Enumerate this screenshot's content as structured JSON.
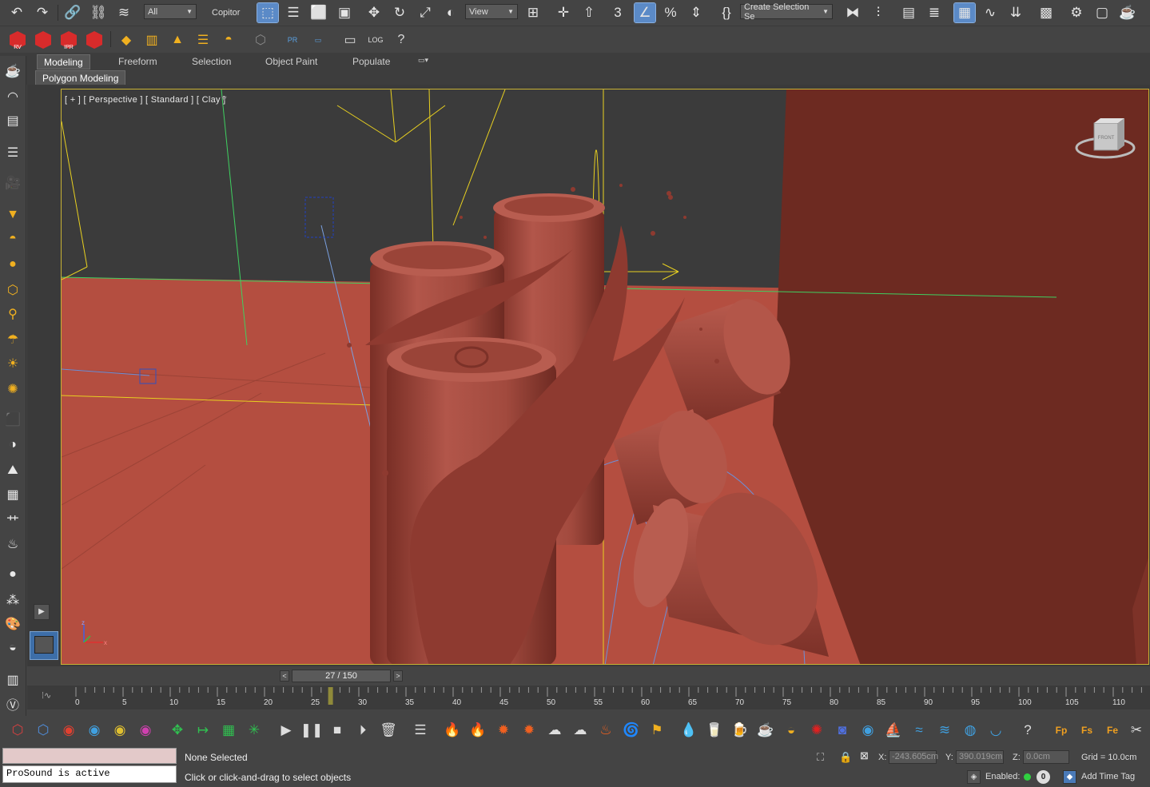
{
  "toolbar": {
    "selection_filter": "All",
    "copitor_label": "Copitor",
    "view_dropdown": "View",
    "create_selection_set": "Create Selection Se",
    "icons": [
      "undo-icon",
      "redo-icon",
      "link-icon",
      "unlink-icon",
      "bind-space-warp-icon",
      "select-object-icon",
      "select-by-name-icon",
      "rect-select-icon",
      "window-crossing-icon",
      "move-icon",
      "rotate-icon",
      "scale-icon",
      "placement-icon",
      "pivot-icon",
      "snap-3d-icon",
      "angle-snap-icon",
      "percent-snap-icon",
      "spinner-snap-icon",
      "named-selection-icon",
      "mirror-icon",
      "align-icon",
      "scene-explorer-icon",
      "layer-explorer-icon",
      "ribbon-icon",
      "curve-editor-icon",
      "schematic-icon",
      "material-editor-icon",
      "render-setup-icon",
      "render-frame-icon",
      "render-icon"
    ]
  },
  "toolbar2": {
    "icons": [
      "vray-rv-icon",
      "vray-render-icon",
      "vray-ipr-icon",
      "vray-ipr-alt-icon",
      "vray-light-icon",
      "vray-plane-icon",
      "vray-flame-icon",
      "vray-fur-icon",
      "vray-dome-icon",
      "vray-proxy-icon",
      "pr-icon",
      "pr-alt-icon",
      "script-editor-icon",
      "log-icon",
      "help-icon"
    ],
    "badges": {
      "rv": "RV",
      "ipr": "IPR",
      "pr": "PR",
      "log": "LOG"
    }
  },
  "ribbon": {
    "tabs": [
      "Modeling",
      "Freeform",
      "Selection",
      "Object Paint",
      "Populate"
    ],
    "active_tab": "Modeling",
    "sub_label": "Polygon Modeling"
  },
  "viewport": {
    "label": "[ + ] [ Perspective ] [ Standard ] [ Clay ]",
    "viewcube_label": "FRONT",
    "axis_labels": {
      "z": "z",
      "x": "x"
    }
  },
  "timeline": {
    "frame_display": "27 / 150",
    "current_frame": 27,
    "total_frames": 150,
    "ticks": [
      "0",
      "5",
      "10",
      "15",
      "20",
      "25",
      "30",
      "35",
      "40",
      "45",
      "50",
      "55",
      "60",
      "65",
      "70",
      "75",
      "80",
      "85",
      "90",
      "95",
      "100",
      "105",
      "110"
    ]
  },
  "status": {
    "maxscript_output": "ProSound is active",
    "selection_status": "None Selected",
    "prompt": "Click or click-and-drag to select objects",
    "x_label": "X:",
    "x_value": "-243.605cm",
    "y_label": "Y:",
    "y_value": "390.019cm",
    "z_label": "Z:",
    "z_value": "0.0cm",
    "grid": "Grid = 10.0cm",
    "enabled_label": "Enabled:",
    "enabled_count": "0",
    "add_time_tag": "Add Time Tag"
  },
  "colors": {
    "ui_bg": "#444444",
    "viewport_active": "#c8b234",
    "clay": "#a8463a",
    "floor": "#b24b3c",
    "wall": "#6e2a20"
  }
}
